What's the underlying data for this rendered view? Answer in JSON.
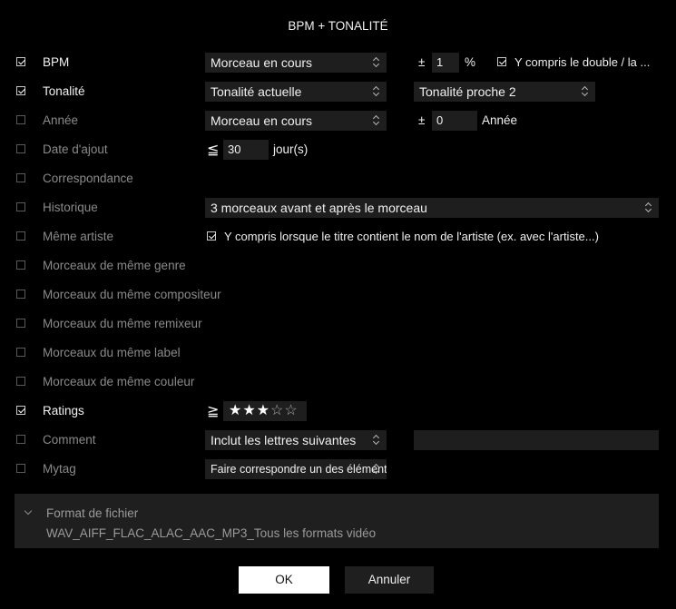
{
  "window": {
    "title": "BPM + TONALITÉ"
  },
  "rows": {
    "bpm": {
      "label": "BPM",
      "checked": true,
      "select": "Morceau en cours",
      "pm": "±",
      "value": "1",
      "unit": "%",
      "option": "Y compris le double / la ..."
    },
    "key": {
      "label": "Tonalité",
      "checked": true,
      "select": "Tonalité actuelle",
      "select2": "Tonalité proche 2"
    },
    "year": {
      "label": "Année",
      "checked": false,
      "select": "Morceau en cours",
      "pm": "±",
      "value": "0",
      "unit": "Année"
    },
    "date_added": {
      "label": "Date d'ajout",
      "checked": false,
      "op": "≦",
      "value": "30",
      "unit": "jour(s)"
    },
    "match": {
      "label": "Correspondance",
      "checked": false
    },
    "history": {
      "label": "Historique",
      "checked": false,
      "select": "3 morceaux avant et après le morceau"
    },
    "same_artist": {
      "label": "Même artiste",
      "checked": false,
      "option": "Y compris lorsque le titre contient le nom de l'artiste (ex. avec l'artiste...)"
    },
    "same_genre": {
      "label": "Morceaux de même genre",
      "checked": false
    },
    "same_composer": {
      "label": "Morceaux du même compositeur",
      "checked": false
    },
    "same_remixer": {
      "label": "Morceaux du même remixeur",
      "checked": false
    },
    "same_label": {
      "label": "Morceaux du même label",
      "checked": false
    },
    "same_color": {
      "label": "Morceaux de même couleur",
      "checked": false
    },
    "ratings": {
      "label": "Ratings",
      "checked": true,
      "op": "≧",
      "stars_filled": "★★★",
      "stars_empty": "☆☆",
      "rating": 3,
      "rating_max": 5
    },
    "comment": {
      "label": "Comment",
      "checked": false,
      "select": "Inclut les lettres suivantes",
      "value": ""
    },
    "mytag": {
      "label": "Mytag",
      "checked": false,
      "select": "Faire correspondre un des éléments"
    }
  },
  "file_format": {
    "title": "Format de fichier",
    "value": "WAV_AIFF_FLAC_ALAC_AAC_MP3_Tous les formats vidéo"
  },
  "buttons": {
    "ok": "OK",
    "cancel": "Annuler"
  }
}
